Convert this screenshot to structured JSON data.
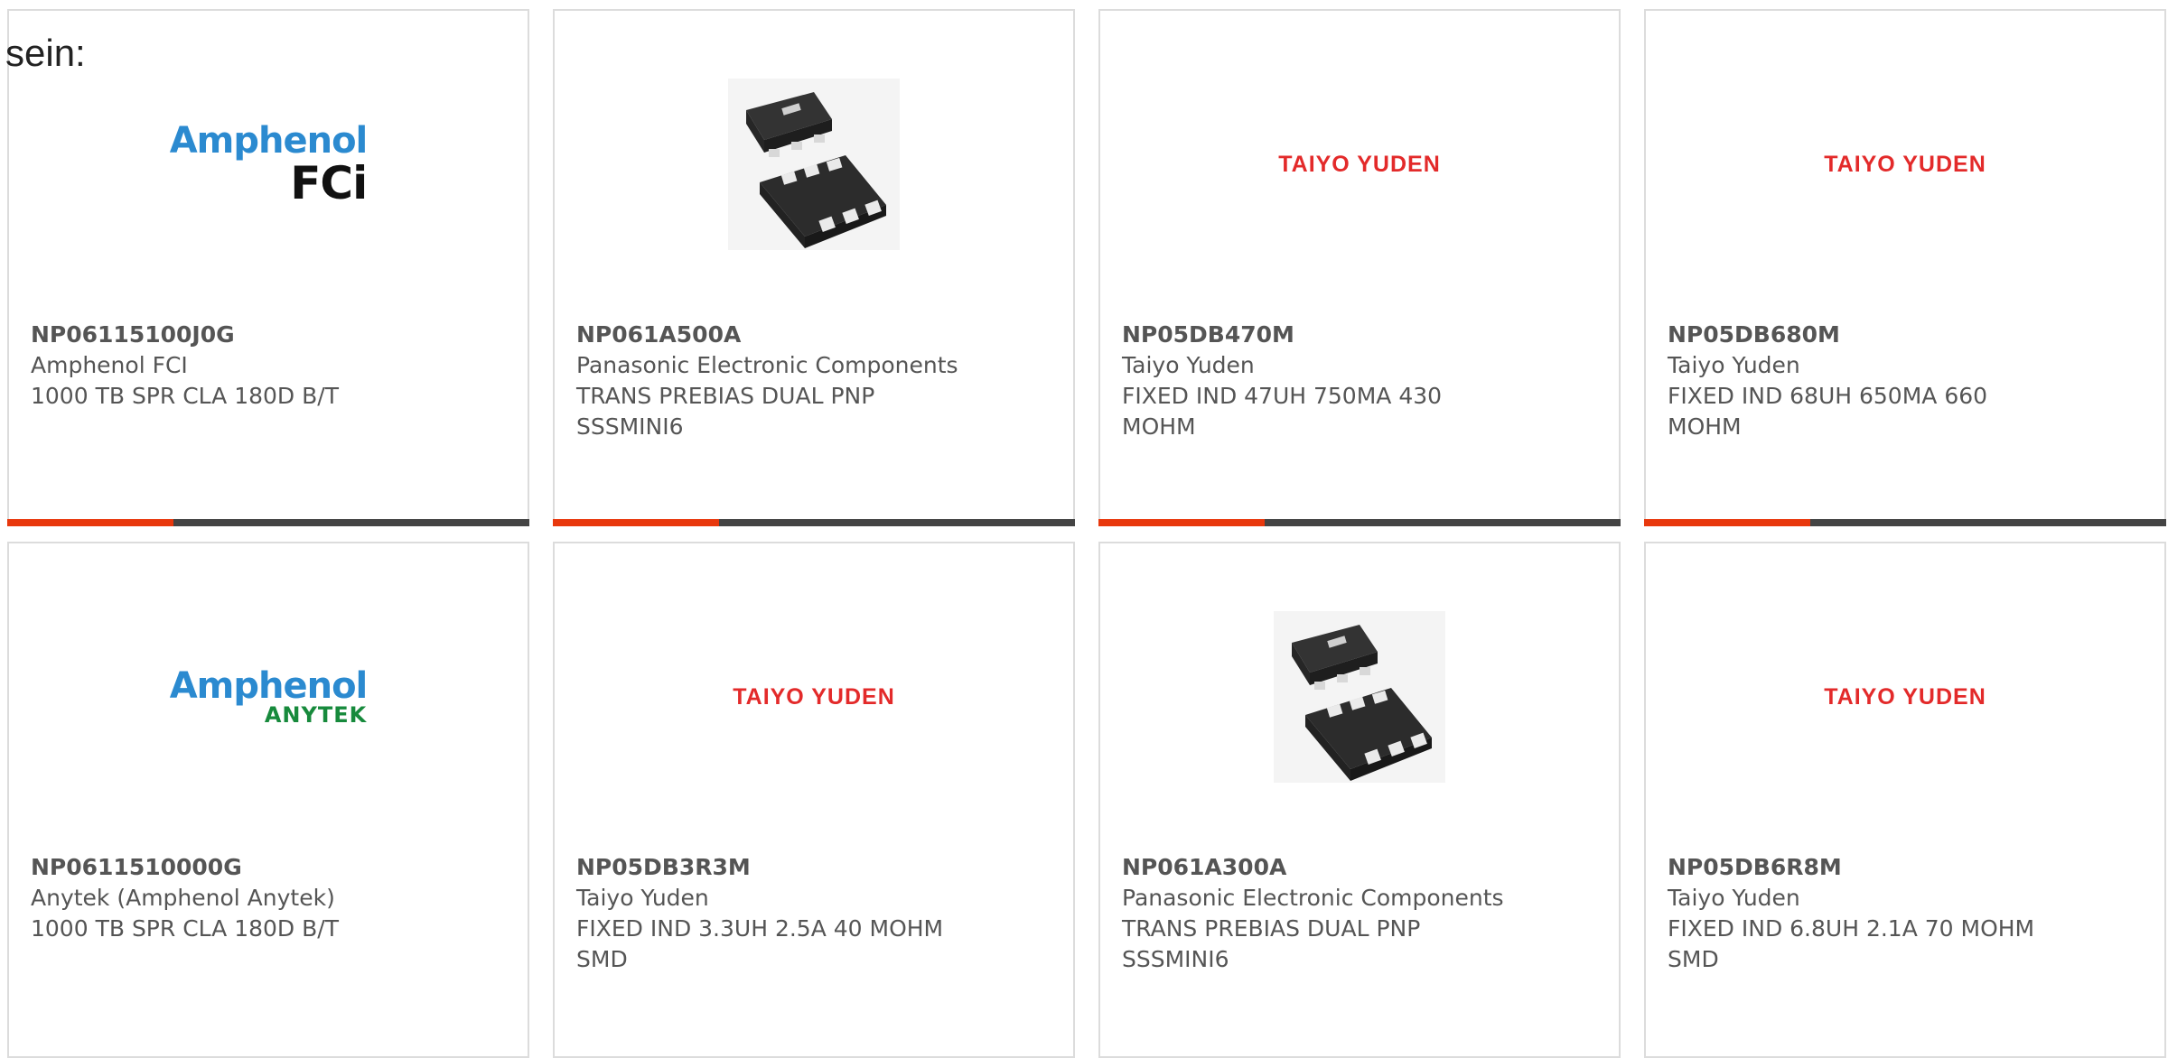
{
  "lead_text": "sein:",
  "colors": {
    "accent_bar": "#e8380d",
    "bar": "#444444",
    "taiyo_red": "#e32a2a",
    "amphenol_blue": "#2b8ad0",
    "anytek_green": "#178a3c"
  },
  "products": [
    {
      "part": "NP06115100J0G",
      "manufacturer": "Amphenol FCI",
      "description": "1000 TB SPR CLA 180D B/T",
      "image": "amphenol-fci-logo",
      "logo_top": "Amphenol",
      "logo_bottom": "FCi"
    },
    {
      "part": "NP061A500A",
      "manufacturer": "Panasonic Electronic Components",
      "description": "TRANS PREBIAS DUAL PNP SSSMINI6",
      "image": "smd-chip-photo"
    },
    {
      "part": "NP05DB470M",
      "manufacturer": "Taiyo Yuden",
      "description": "FIXED IND 47UH 750MA 430 MOHM",
      "image": "taiyo-yuden-logo",
      "logo_text": "TAIYO YUDEN"
    },
    {
      "part": "NP05DB680M",
      "manufacturer": "Taiyo Yuden",
      "description": "FIXED IND 68UH 650MA 660 MOHM",
      "image": "taiyo-yuden-logo",
      "logo_text": "TAIYO YUDEN"
    },
    {
      "part": "NP0611510000G",
      "manufacturer": "Anytek (Amphenol Anytek)",
      "description": "1000 TB SPR CLA 180D B/T",
      "image": "amphenol-anytek-logo",
      "logo_top": "Amphenol",
      "logo_bottom": "ANYTEK"
    },
    {
      "part": "NP05DB3R3M",
      "manufacturer": "Taiyo Yuden",
      "description": "FIXED IND 3.3UH 2.5A 40 MOHM SMD",
      "image": "taiyo-yuden-logo",
      "logo_text": "TAIYO YUDEN"
    },
    {
      "part": "NP061A300A",
      "manufacturer": "Panasonic Electronic Components",
      "description": "TRANS PREBIAS DUAL PNP SSSMINI6",
      "image": "smd-chip-photo"
    },
    {
      "part": "NP05DB6R8M",
      "manufacturer": "Taiyo Yuden",
      "description": "FIXED IND 6.8UH 2.1A 70 MOHM SMD",
      "image": "taiyo-yuden-logo",
      "logo_text": "TAIYO YUDEN"
    }
  ]
}
